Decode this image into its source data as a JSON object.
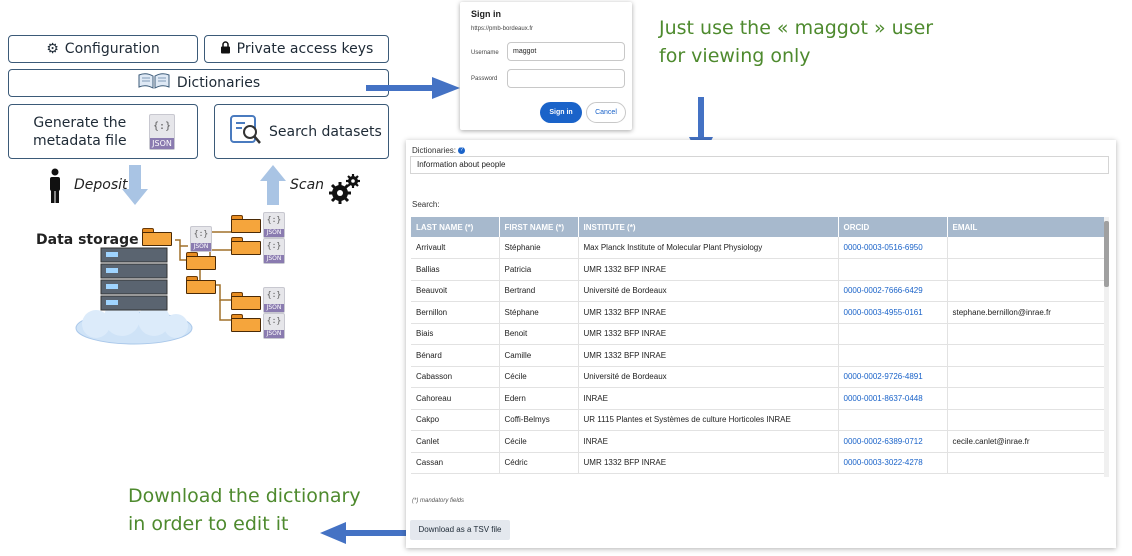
{
  "menu": {
    "configuration": "Configuration",
    "private_keys": "Private access keys",
    "dictionaries": "Dictionaries",
    "generate_line1": "Generate the",
    "generate_line2": "metadata file",
    "search_datasets": "Search datasets"
  },
  "flow": {
    "deposit": "Deposit",
    "scan": "Scan",
    "data_storage": "Data storage",
    "json_tag": "JSON",
    "json_braces": "{:}"
  },
  "annotations": {
    "maggot_line1": "Just use the « maggot » user",
    "maggot_line2": "for viewing only",
    "download_line1": "Download the dictionary",
    "download_line2": "in order to edit it"
  },
  "signin": {
    "title": "Sign in",
    "host": "https://pmb-bordeaux.fr",
    "username_label": "Username",
    "username_value": "maggot",
    "password_label": "Password",
    "password_value": "",
    "sign_in_button": "Sign in",
    "cancel_button": "Cancel"
  },
  "dictionary_panel": {
    "label": "Dictionaries:",
    "selected": "Information about people",
    "search_label": "Search:",
    "mandatory_note": "(*) mandatory fields",
    "download_button": "Download as a TSV file",
    "columns": [
      "LAST NAME (*)",
      "FIRST NAME (*)",
      "INSTITUTE (*)",
      "ORCID",
      "EMAIL"
    ],
    "rows": [
      [
        "Arrivault",
        "Stéphanie",
        "Max Planck Institute of Molecular Plant Physiology",
        "0000-0003-0516-6950",
        ""
      ],
      [
        "Ballias",
        "Patricia",
        "UMR 1332 BFP INRAE",
        "",
        ""
      ],
      [
        "Beauvoit",
        "Bertrand",
        "Université de Bordeaux",
        "0000-0002-7666-6429",
        ""
      ],
      [
        "Bernillon",
        "Stéphane",
        "UMR 1332 BFP INRAE",
        "0000-0003-4955-0161",
        "stephane.bernillon@inrae.fr"
      ],
      [
        "Biais",
        "Benoit",
        "UMR 1332 BFP INRAE",
        "",
        ""
      ],
      [
        "Bénard",
        "Camille",
        "UMR 1332 BFP INRAE",
        "",
        ""
      ],
      [
        "Cabasson",
        "Cécile",
        "Université de Bordeaux",
        "0000-0002-9726-4891",
        ""
      ],
      [
        "Cahoreau",
        "Edern",
        "INRAE",
        "0000-0001-8637-0448",
        ""
      ],
      [
        "Cakpo",
        "Coffi-Belmys",
        "UR 1115 Plantes et Systèmes de culture Horticoles INRAE",
        "",
        ""
      ],
      [
        "Canlet",
        "Cécile",
        "INRAE",
        "0000-0002-6389-0712",
        "cecile.canlet@inrae.fr"
      ],
      [
        "Cassan",
        "Cédric",
        "UMR 1332 BFP INRAE",
        "0000-0003-3022-4278",
        ""
      ]
    ]
  },
  "colors": {
    "accent_blue": "#4472c4",
    "annotation_green": "#4e8a2e",
    "table_header": "#a7b9cd",
    "folder_orange": "#f5a53c"
  }
}
